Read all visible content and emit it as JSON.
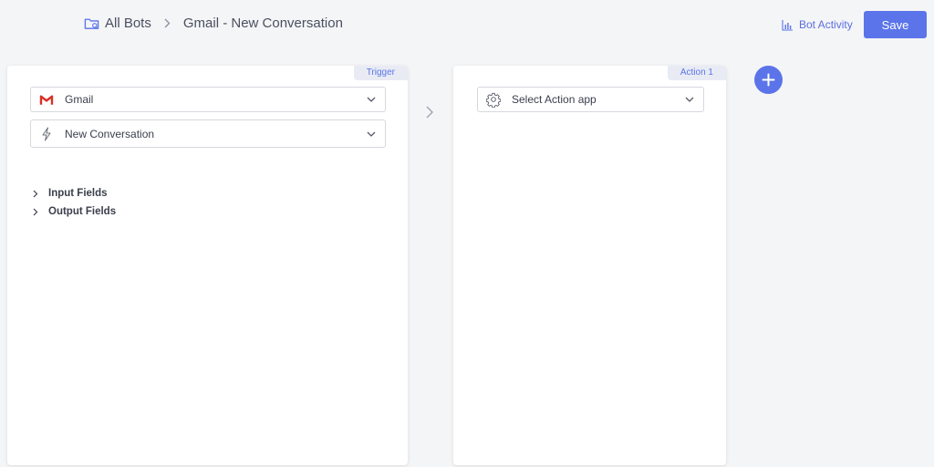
{
  "breadcrumb": {
    "root": "All Bots",
    "current": "Gmail - New Conversation"
  },
  "header": {
    "bot_activity_label": "Bot Activity",
    "save_label": "Save"
  },
  "trigger_panel": {
    "tag": "Trigger",
    "app_label": "Gmail",
    "event_label": "New Conversation",
    "input_fields_label": "Input Fields",
    "output_fields_label": "Output Fields"
  },
  "action_panel": {
    "tag": "Action 1",
    "app_placeholder": "Select Action app"
  },
  "icons": {
    "folder": "folder-bot-icon",
    "chart": "bar-chart-icon",
    "gmail": "gmail-icon",
    "event": "lightning-icon",
    "action_app": "gear-icon",
    "add": "plus-icon",
    "chevron": "chevron-down-icon",
    "expand": "chevron-right-icon"
  },
  "colors": {
    "accent": "#5b74ea",
    "background": "#f4f5f7",
    "gmail_red": "#d93025"
  }
}
